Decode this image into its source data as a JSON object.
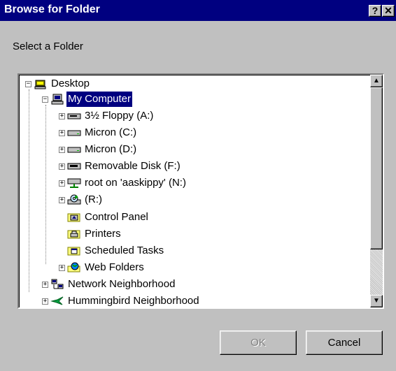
{
  "window": {
    "title": "Browse for Folder",
    "help_label": "?",
    "close_label": "✕"
  },
  "prompt": "Select a Folder",
  "tree": {
    "items": [
      {
        "label": "Desktop",
        "icon": "desktop-icon",
        "expander": "−"
      },
      {
        "label": "My Computer",
        "icon": "computer-icon",
        "expander": "−",
        "selected": true
      },
      {
        "label": "3½ Floppy (A:)",
        "icon": "floppy-drive-icon",
        "expander": "+"
      },
      {
        "label": "Micron (C:)",
        "icon": "hard-drive-icon",
        "expander": "+"
      },
      {
        "label": "Micron (D:)",
        "icon": "hard-drive-icon",
        "expander": "+"
      },
      {
        "label": "Removable Disk (F:)",
        "icon": "removable-disk-icon",
        "expander": "+"
      },
      {
        "label": "root on 'aaskippy' (N:)",
        "icon": "network-drive-icon",
        "expander": "+"
      },
      {
        "label": "(R:)",
        "icon": "cd-drive-icon",
        "expander": "+"
      },
      {
        "label": "Control Panel",
        "icon": "control-panel-icon",
        "expander": ""
      },
      {
        "label": "Printers",
        "icon": "printers-folder-icon",
        "expander": ""
      },
      {
        "label": "Scheduled Tasks",
        "icon": "scheduled-tasks-icon",
        "expander": ""
      },
      {
        "label": "Web Folders",
        "icon": "web-folders-icon",
        "expander": "+"
      },
      {
        "label": "Network Neighborhood",
        "icon": "network-neighborhood-icon",
        "expander": "+"
      },
      {
        "label": "Hummingbird Neighborhood",
        "icon": "hummingbird-icon",
        "expander": "+"
      }
    ]
  },
  "scrollbar": {
    "up": "▲",
    "down": "▼"
  },
  "buttons": {
    "ok": "OK",
    "cancel": "Cancel"
  },
  "colors": {
    "titlebar": "#000080",
    "face": "#c0c0c0",
    "selection": "#000080"
  }
}
